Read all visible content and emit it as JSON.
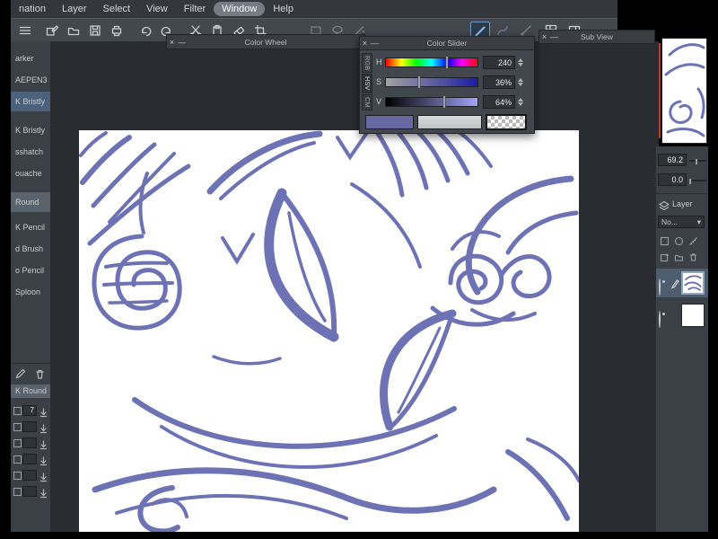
{
  "colors": {
    "artwork_stroke": "#6d72b4",
    "main_swatch": "#6868a3",
    "sub_swatch": "#c9cccd",
    "selection_blue": "#4c617a"
  },
  "menu_bar": {
    "items": [
      "nation",
      "Layer",
      "Select",
      "View",
      "Filter",
      "Window",
      "Help"
    ],
    "active_item": "Window"
  },
  "glyphs": {
    "close": "×",
    "minimize": "—",
    "dropdown": "▾"
  },
  "toolbar": {
    "icons": [
      "menu",
      "new-file",
      "folder",
      "save",
      "print",
      "undo",
      "redo",
      "cut",
      "clipboard",
      "eraser",
      "crop",
      "select-area",
      "lasso",
      "magic-wand",
      "line-tool",
      "curve-tool",
      "pen-slash",
      "grid",
      "sub-view"
    ]
  },
  "sidebar": {
    "brushes": [
      {
        "label": "arker",
        "selected": false
      },
      {
        "label": "AEPEN3",
        "selected": false
      },
      {
        "label": "K Bristly",
        "selected": true
      },
      {
        "label": "K Bristly",
        "selected": false
      },
      {
        "label": "sshatch",
        "selected": false
      },
      {
        "label": "ouache",
        "selected": false
      },
      {
        "label": "Round",
        "selected": true
      },
      {
        "label": "K Pencil",
        "selected": false
      },
      {
        "label": "d Brush",
        "selected": false
      },
      {
        "label": "o Pencil",
        "selected": false
      },
      {
        "label": "Sploon",
        "selected": false
      }
    ]
  },
  "sub_tool_detail": {
    "name": "K Round",
    "value": "7"
  },
  "panels": {
    "color_wheel": {
      "title": "Color Wheel"
    },
    "color_slider": {
      "title": "Color Slider",
      "tabs": [
        {
          "label": "RGB",
          "active": false
        },
        {
          "label": "HSV",
          "active": true
        },
        {
          "label": "CM",
          "active": false
        }
      ],
      "sliders": [
        {
          "label": "H",
          "value": "240",
          "pos": 66.7
        },
        {
          "label": "S",
          "value": "36%",
          "pos": 36
        },
        {
          "label": "V",
          "value": "64%",
          "pos": 64
        }
      ]
    },
    "sub_view": {
      "title": "Sub View"
    }
  },
  "tool_property": {
    "rows": [
      {
        "value": "69.2",
        "pos": 42
      },
      {
        "value": "0.0",
        "pos": 5
      }
    ]
  },
  "layer_panel": {
    "title": "Layer",
    "blend_mode": "No..."
  }
}
